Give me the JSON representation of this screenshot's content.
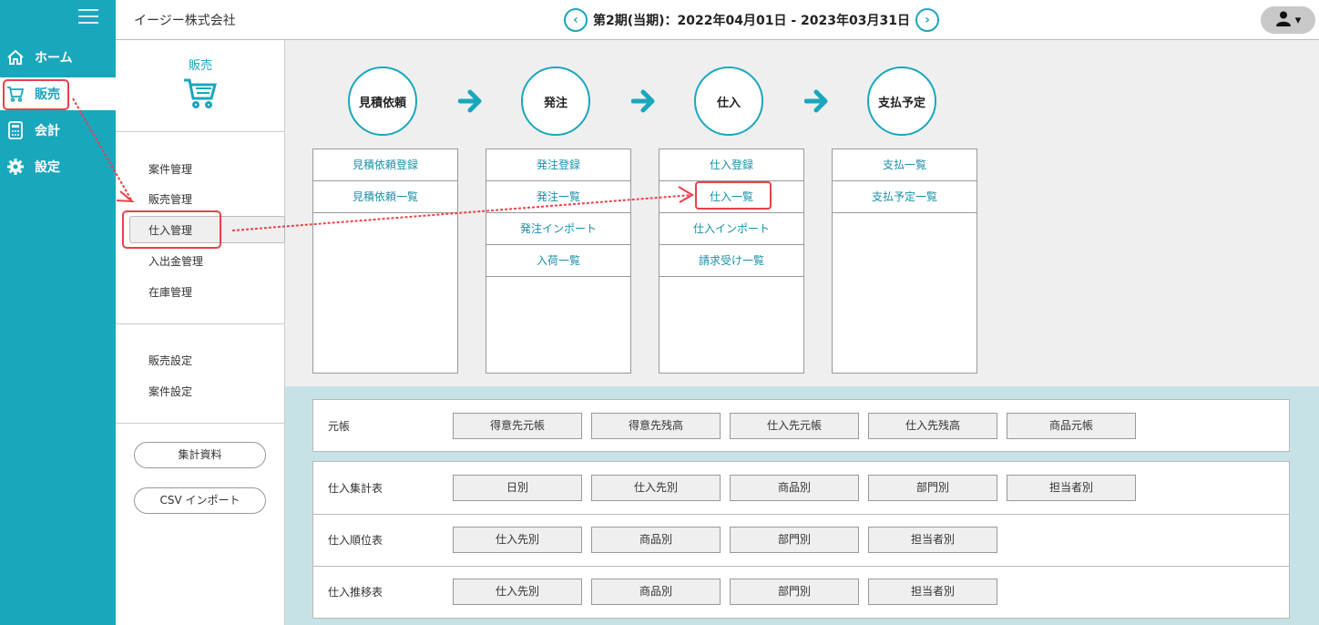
{
  "header": {
    "company": "イージー株式会社",
    "period": "第2期(当期)：2022年04月01日 - 2023年03月31日",
    "prev": "‹",
    "next": "›",
    "user_caret": "▾"
  },
  "nav": {
    "items": [
      {
        "label": "ホーム",
        "icon": "home-icon"
      },
      {
        "label": "販売",
        "icon": "cart-icon",
        "active": true
      },
      {
        "label": "会計",
        "icon": "calculator-icon"
      },
      {
        "label": "設定",
        "icon": "gear-icon"
      }
    ]
  },
  "sidebar": {
    "title": "販売",
    "group1": [
      "案件管理",
      "販売管理",
      "仕入管理",
      "入出金管理",
      "在庫管理"
    ],
    "group2": [
      "販売設定",
      "案件設定"
    ],
    "buttons": [
      "集計資料",
      "CSV インポート"
    ]
  },
  "flow": {
    "steps": [
      "見積依頼",
      "発注",
      "仕入",
      "支払予定"
    ],
    "columns": [
      [
        "見積依頼登録",
        "見積依頼一覧"
      ],
      [
        "発注登録",
        "発注一覧",
        "発注インポート",
        "入荷一覧"
      ],
      [
        "仕入登録",
        "仕入一覧",
        "仕入インポート",
        "請求受け一覧"
      ],
      [
        "支払一覧",
        "支払予定一覧"
      ]
    ]
  },
  "ledger": {
    "label": "元帳",
    "buttons": [
      "得意先元帳",
      "得意先残高",
      "仕入先元帳",
      "仕入先残高",
      "商品元帳"
    ]
  },
  "reports": [
    {
      "label": "仕入集計表",
      "buttons": [
        "日別",
        "仕入先別",
        "商品別",
        "部門別",
        "担当者別"
      ]
    },
    {
      "label": "仕入順位表",
      "buttons": [
        "仕入先別",
        "商品別",
        "部門別",
        "担当者別"
      ]
    },
    {
      "label": "仕入推移表",
      "buttons": [
        "仕入先別",
        "商品別",
        "部門別",
        "担当者別"
      ]
    }
  ],
  "colors": {
    "accent": "#19a7bd",
    "annotation": "#e8424a"
  }
}
